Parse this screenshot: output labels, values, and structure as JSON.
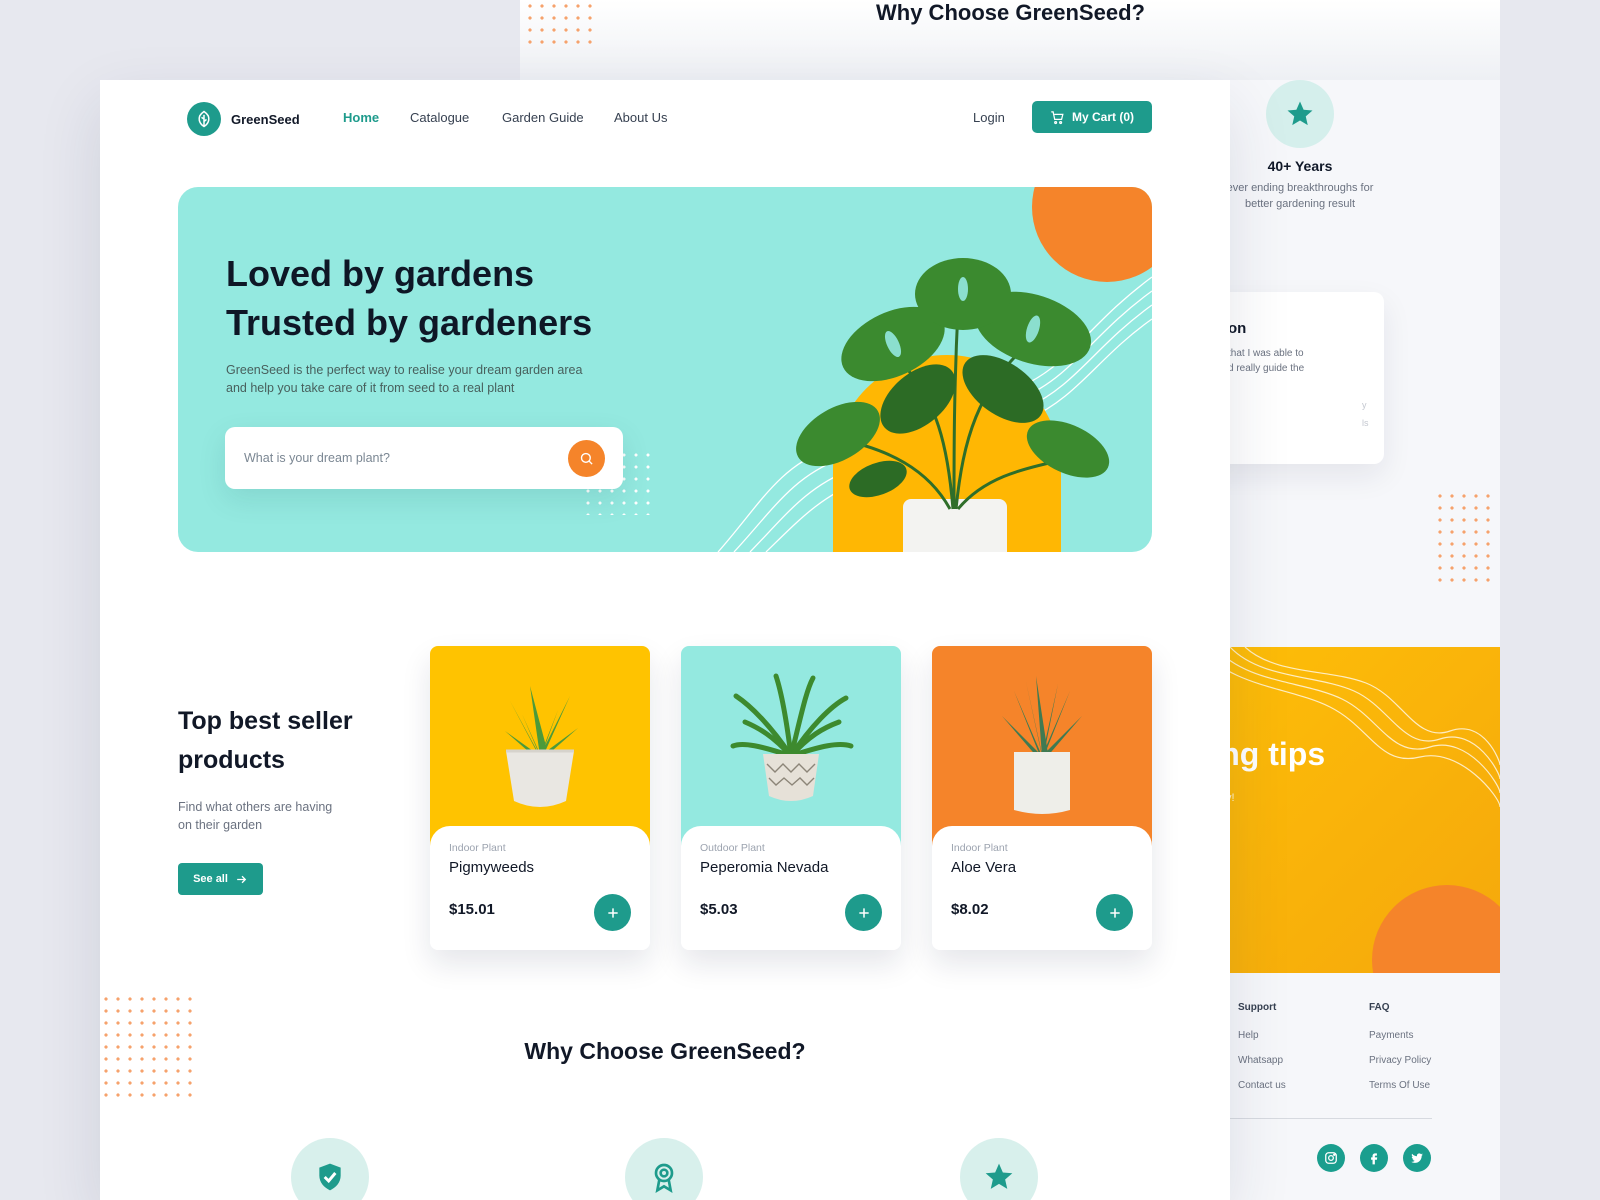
{
  "brand": {
    "name": "GreenSeed"
  },
  "colors": {
    "primary": "#1e9b8c",
    "accent_orange": "#f5842a",
    "accent_yellow": "#ffb703",
    "hero_bg": "#94e9e0"
  },
  "nav": {
    "items": [
      "Home",
      "Catalogue",
      "Garden Guide",
      "About Us"
    ],
    "active": "Home",
    "login": "Login",
    "cart": "My Cart (0)"
  },
  "hero": {
    "title_line1": "Loved by gardens",
    "title_line2": "Trusted by gardeners",
    "subtitle": "GreenSeed is the perfect way to realise your dream garden area and help you take care of it from seed to a real plant",
    "search_placeholder": "What is your dream plant?"
  },
  "best_seller": {
    "title_line1": "Top best seller",
    "title_line2": "products",
    "subtitle": "Find what others are having on their garden",
    "see_all": "See all",
    "products": [
      {
        "category": "Indoor Plant",
        "name": "Pigmyweeds",
        "price": "$15.01",
        "bg": "#ffc300"
      },
      {
        "category": "Outdoor Plant",
        "name": "Peperomia Nevada",
        "price": "$5.03",
        "bg": "#94e9e0"
      },
      {
        "category": "Indoor Plant",
        "name": "Aloe Vera",
        "price": "$8.02",
        "bg": "#f5842a"
      }
    ]
  },
  "why": {
    "title": "Why Choose GreenSeed?",
    "icons": [
      "shield-check-icon",
      "award-ribbon-icon",
      "star-icon"
    ]
  },
  "back_page": {
    "title": "Why Choose GreenSeed?",
    "years_title": "40+ Years",
    "years_desc_line1": "ever ending breakthroughs for",
    "years_desc_line2": "better gardening result",
    "card_title": "on",
    "card_line1": "that I was able to",
    "card_line2": "d really guide the",
    "card_faint_1": "y",
    "card_faint_2": "ls",
    "tips_title": "ening tips",
    "tips_sub": "y!",
    "footer": {
      "support": {
        "head": "Support",
        "links": [
          "Help",
          "Whatsapp",
          "Contact us"
        ]
      },
      "faq": {
        "head": "FAQ",
        "links": [
          "Payments",
          "Privacy Policy",
          "Terms Of Use"
        ]
      }
    },
    "socials": [
      "instagram-icon",
      "facebook-icon",
      "twitter-icon"
    ]
  }
}
